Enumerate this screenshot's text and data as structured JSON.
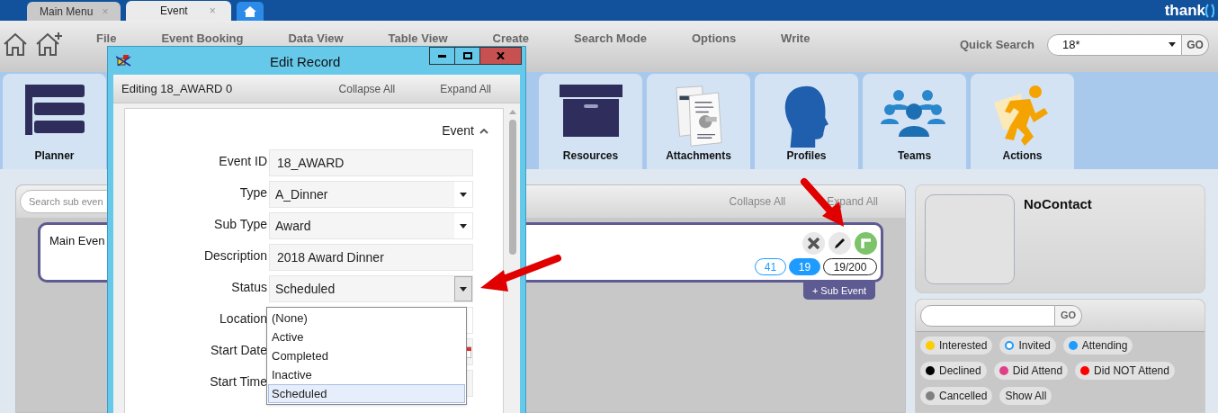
{
  "tabs": [
    {
      "label": "Main Menu",
      "selected": false,
      "close": "×"
    },
    {
      "label": "Event",
      "selected": true,
      "close": "×"
    }
  ],
  "logo": {
    "text": "thank"
  },
  "menu": [
    "File",
    "Event Booking",
    "Data View",
    "Table View",
    "Create",
    "Search Mode",
    "Options",
    "Write"
  ],
  "quick_search": {
    "label": "Quick Search",
    "value": "18*",
    "button": "GO"
  },
  "modules": [
    {
      "label": "Planner",
      "kind": "planner"
    },
    {
      "label": "Resources",
      "kind": "resources"
    },
    {
      "label": "Attachments",
      "kind": "attachments"
    },
    {
      "label": "Profiles",
      "kind": "profiles"
    },
    {
      "label": "Teams",
      "kind": "teams"
    },
    {
      "label": "Actions",
      "kind": "actions"
    }
  ],
  "event_panel": {
    "search_placeholder": "Search sub even",
    "collapse": "Collapse All",
    "expand": "Expand All",
    "card": {
      "title": "Main Even",
      "counts": [
        {
          "label": "41",
          "kind": "outline"
        },
        {
          "label": "19",
          "kind": "filled"
        },
        {
          "label": "19/200",
          "kind": "plain"
        }
      ],
      "sub_event_button": "+ Sub Event"
    }
  },
  "contact": {
    "name": "NoContact",
    "search_button": "GO",
    "filters": [
      {
        "label": "Interested",
        "kind": "dot",
        "color": "#ffcc00"
      },
      {
        "label": "Invited",
        "kind": "ring",
        "color": "#1e9bff"
      },
      {
        "label": "Attending",
        "kind": "dot",
        "color": "#1e9bff"
      },
      {
        "label": "Declined",
        "kind": "dot",
        "color": "#000000"
      },
      {
        "label": "Did Attend",
        "kind": "dot",
        "color": "#e0408a"
      },
      {
        "label": "Did NOT Attend",
        "kind": "dot",
        "color": "#ff0000"
      },
      {
        "label": "Cancelled",
        "kind": "dot",
        "color": "#808080"
      },
      {
        "label": "Show All",
        "kind": "plain"
      }
    ]
  },
  "dialog": {
    "title": "Edit Record",
    "editing": "Editing 18_AWARD 0",
    "collapse": "Collapse All",
    "expand": "Expand All",
    "section": {
      "title": "Event",
      "expanded": true
    },
    "fields": [
      {
        "label": "Event ID",
        "kind": "text",
        "value": "18_AWARD"
      },
      {
        "label": "Type",
        "kind": "select",
        "value": "A_Dinner",
        "open": false
      },
      {
        "label": "Sub Type",
        "kind": "select",
        "value": "Award",
        "open": false
      },
      {
        "label": "Description",
        "kind": "text",
        "value": "2018 Award Dinner"
      },
      {
        "label": "Status",
        "kind": "select",
        "value": "Scheduled",
        "open": true
      },
      {
        "label": "Location",
        "kind": "select",
        "open": false
      },
      {
        "label": "Start Date",
        "kind": "date"
      },
      {
        "label": "Start Time",
        "kind": "text"
      }
    ],
    "dropdown": [
      {
        "label": "(None)",
        "selected": false
      },
      {
        "label": "Active",
        "selected": false
      },
      {
        "label": "Completed",
        "selected": false
      },
      {
        "label": "Inactive",
        "selected": false
      },
      {
        "label": "Scheduled",
        "selected": true
      }
    ]
  }
}
